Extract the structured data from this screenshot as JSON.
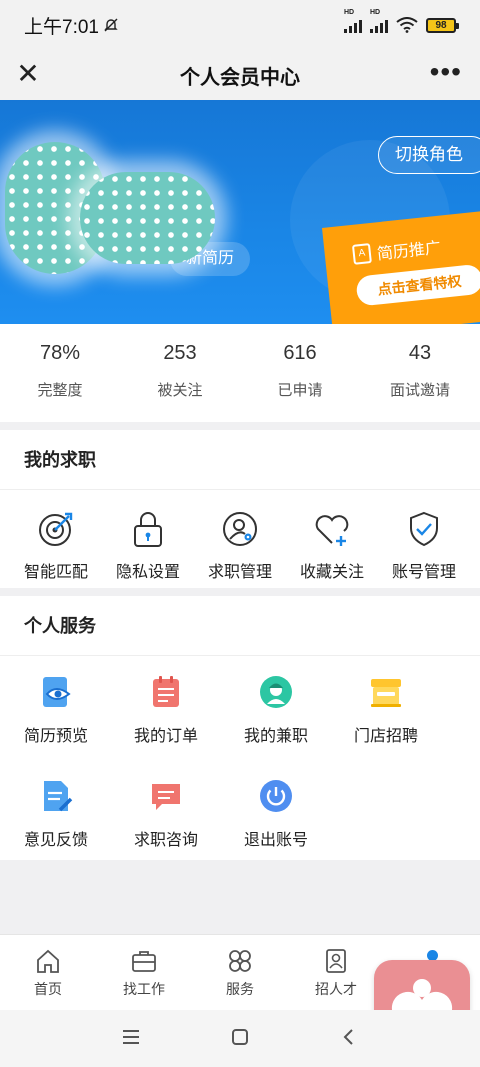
{
  "status": {
    "time": "上午7:01",
    "battery": "98",
    "signal_tag": "HD"
  },
  "header": {
    "title": "个人会员中心",
    "close": "✕",
    "more": "•••"
  },
  "banner": {
    "refresh_label": "新简历",
    "switch_role": "切换角色",
    "promo_title": "简历推广",
    "promo_button": "点击查看特权"
  },
  "stats": [
    {
      "value": "78%",
      "label": "完整度"
    },
    {
      "value": "253",
      "label": "被关注"
    },
    {
      "value": "616",
      "label": "已申请"
    },
    {
      "value": "43",
      "label": "面试邀请"
    }
  ],
  "job_section": {
    "title": "我的求职",
    "items": [
      {
        "label": "智能匹配",
        "icon": "target-icon"
      },
      {
        "label": "隐私设置",
        "icon": "lock-icon"
      },
      {
        "label": "求职管理",
        "icon": "user-gear-icon"
      },
      {
        "label": "收藏关注",
        "icon": "heart-plus-icon"
      },
      {
        "label": "账号管理",
        "icon": "shield-check-icon"
      }
    ]
  },
  "service_section": {
    "title": "个人服务",
    "items": [
      {
        "label": "简历预览",
        "icon": "resume-eye-icon"
      },
      {
        "label": "我的订单",
        "icon": "order-icon"
      },
      {
        "label": "我的兼职",
        "icon": "worker-icon"
      },
      {
        "label": "门店招聘",
        "icon": "store-icon"
      },
      {
        "label": "意见反馈",
        "icon": "feedback-icon"
      },
      {
        "label": "求职咨询",
        "icon": "chat-icon"
      },
      {
        "label": "退出账号",
        "icon": "power-icon"
      }
    ]
  },
  "tabbar": [
    {
      "label": "首页",
      "icon": "home-icon"
    },
    {
      "label": "找工作",
      "icon": "briefcase-icon"
    },
    {
      "label": "服务",
      "icon": "services-icon"
    },
    {
      "label": "招人才",
      "icon": "recruit-icon"
    }
  ],
  "colors": {
    "primary": "#1a86e6",
    "promo": "#ff9f0a",
    "accent_pink": "#ea8f93"
  }
}
